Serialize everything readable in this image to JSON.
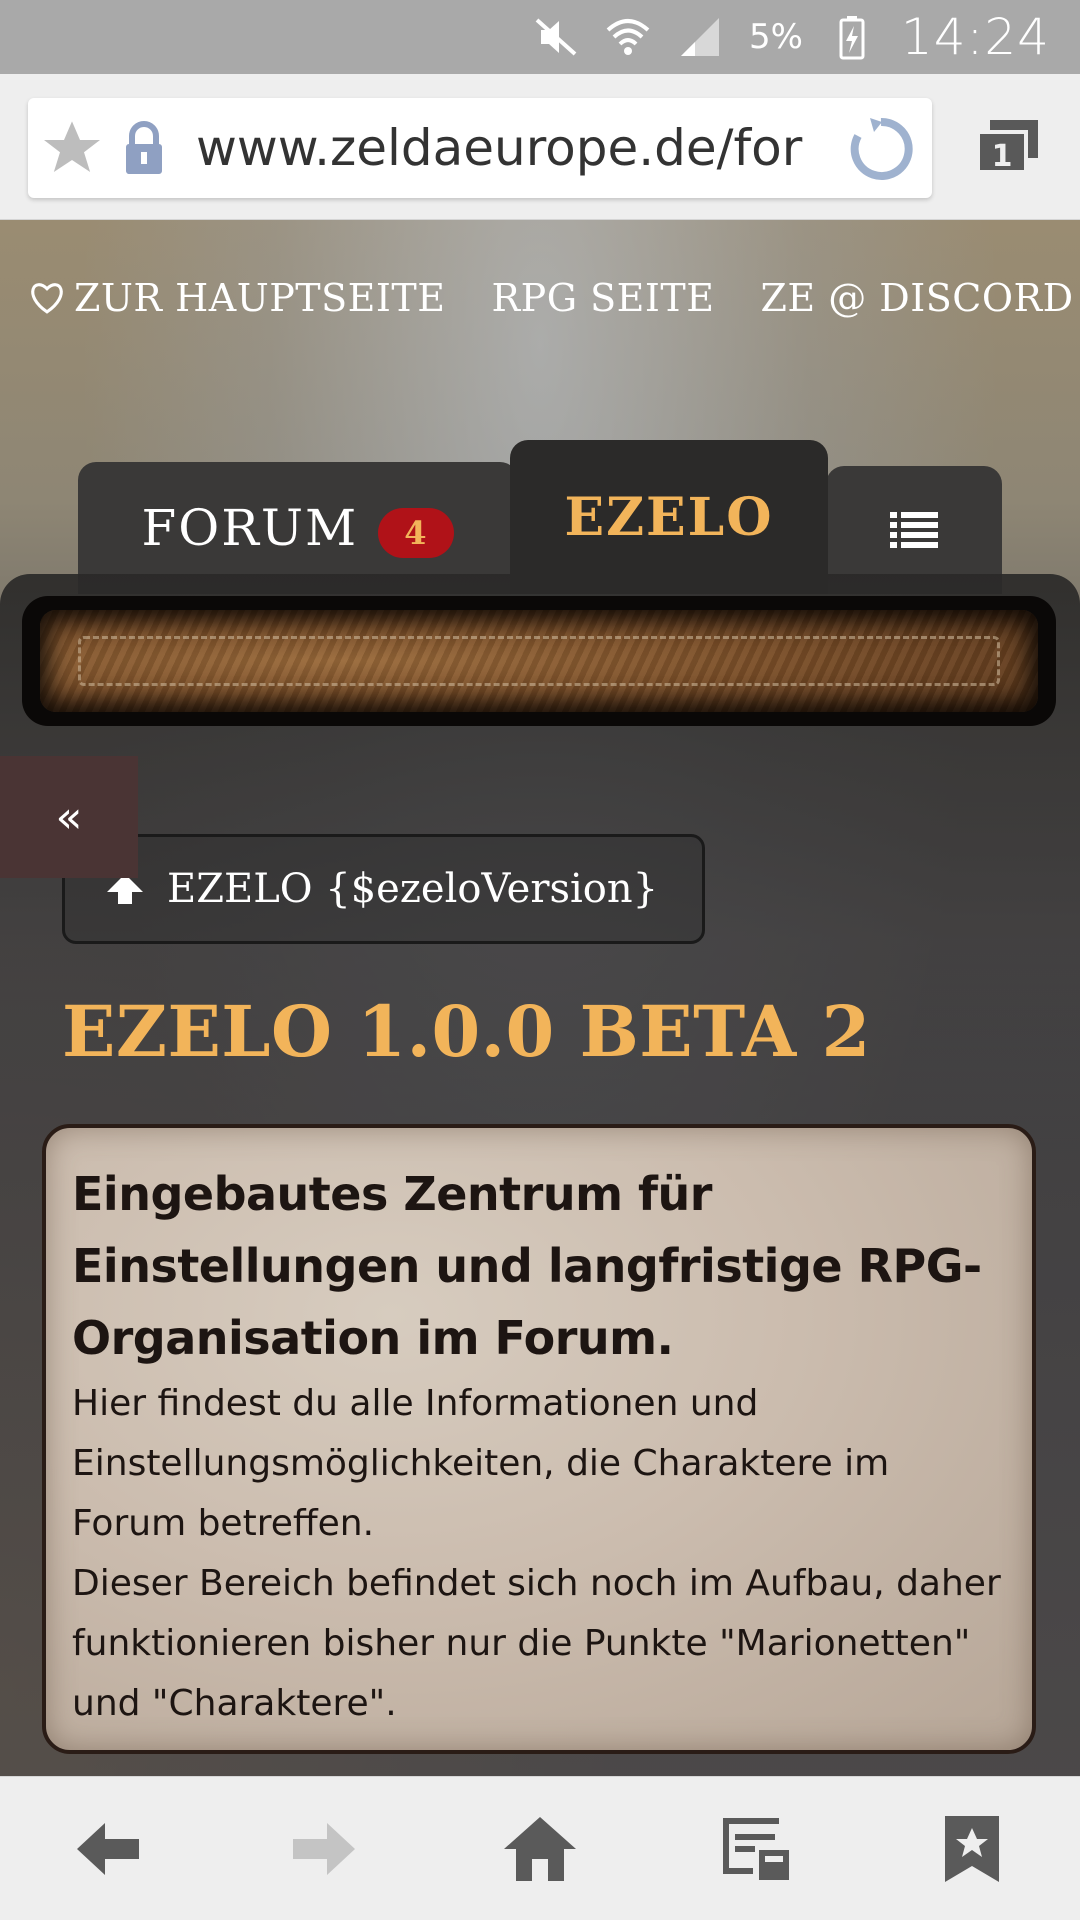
{
  "status_bar": {
    "battery_percent": "5%",
    "clock": "14:24"
  },
  "browser": {
    "url": "www.zeldaeurope.de/forum",
    "tab_count": "1"
  },
  "top_links": {
    "home": "ZUR HAUPTSEITE",
    "rpg": "RPG SEITE",
    "discord": "ZE @ DISCORD"
  },
  "tabs": {
    "forum": "FORUM",
    "forum_badge": "4",
    "ezelo": "EZELO"
  },
  "collapse_label": "«",
  "version_button": "EZELO {$ezeloVersion}",
  "heading": "EZELO 1.0.0 BETA 2",
  "intro": {
    "title": "Eingebautes Zentrum für Einstellungen und langfristige RPG-Organisation im Forum.",
    "paragraph1": "Hier findest du alle Informationen und Einstellungsmöglichkeiten, die Charaktere im Forum betreffen.",
    "paragraph2": "Dieser Bereich befindet sich noch im Aufbau, daher funktionieren bisher nur die Punkte \"Marionetten\" und \"Charaktere\"."
  },
  "colors": {
    "accent_gold": "#f2b45a",
    "badge_red": "#b01218",
    "tab_active": "#2b2a29"
  }
}
